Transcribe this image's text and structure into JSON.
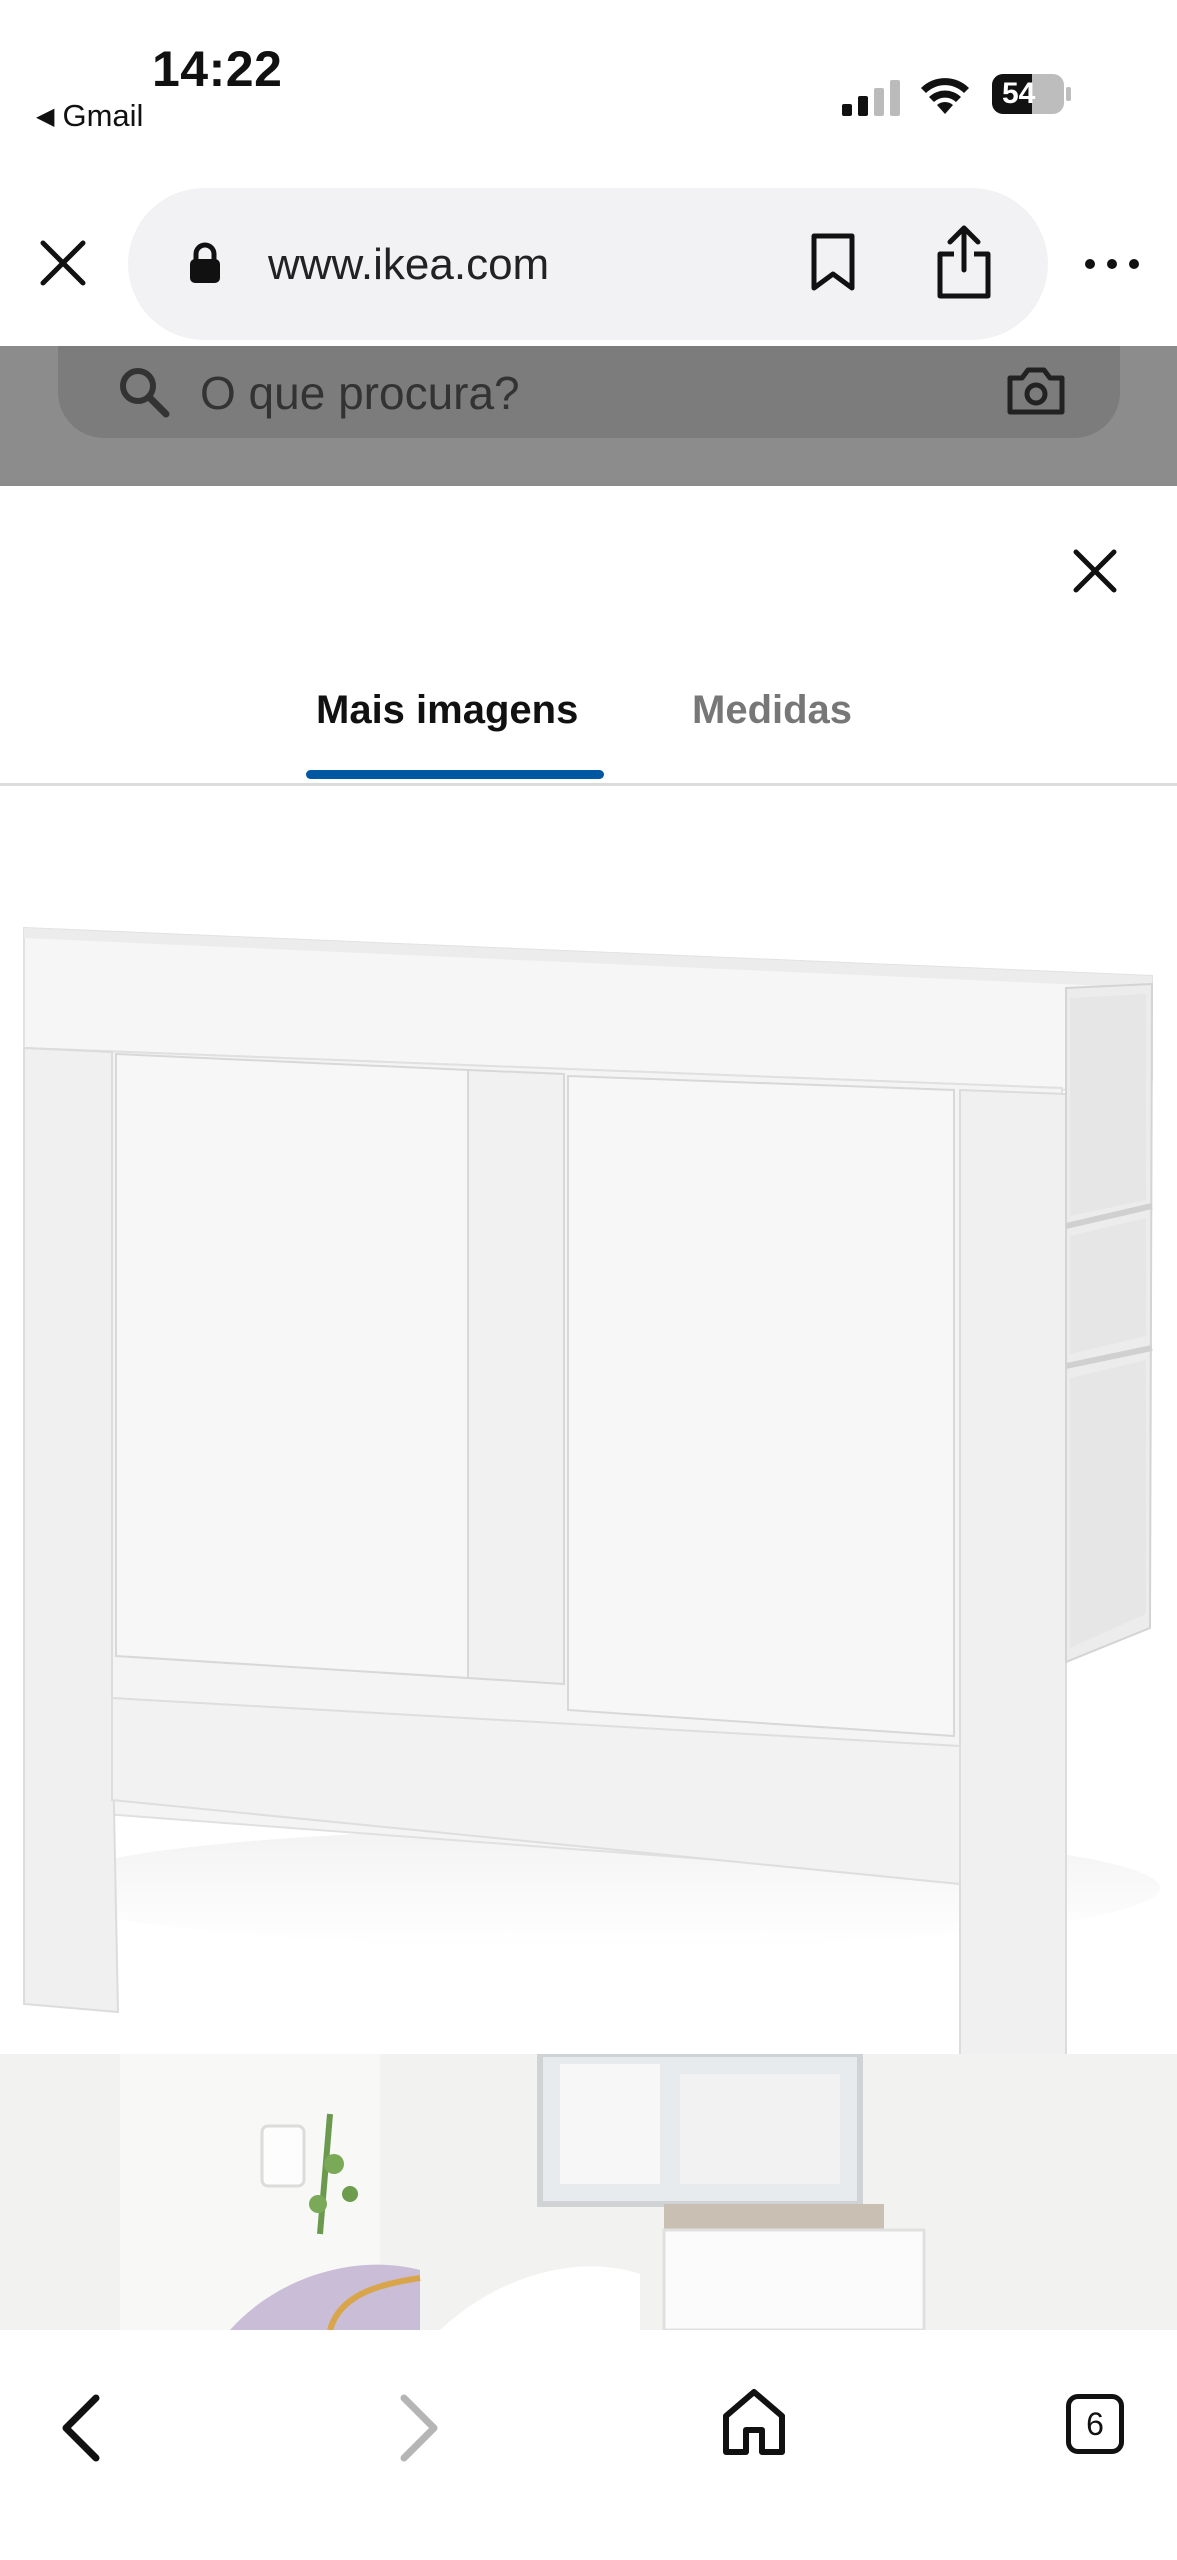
{
  "status_bar": {
    "time": "14:22",
    "back_app_label": "Gmail",
    "battery_level": "54"
  },
  "browser": {
    "url": "www.ikea.com",
    "tab_count": "6",
    "icons": [
      "close-icon",
      "lock-icon",
      "bookmark-icon",
      "share-icon",
      "more-icon",
      "back-arrow-icon",
      "forward-arrow-icon",
      "home-icon",
      "tabs-icon"
    ]
  },
  "page": {
    "search_placeholder": "O que procura?"
  },
  "sheet": {
    "tabs": [
      {
        "label": "Mais imagens",
        "active": true
      },
      {
        "label": "Medidas",
        "active": false
      }
    ],
    "accent_color": "#0058a3"
  }
}
